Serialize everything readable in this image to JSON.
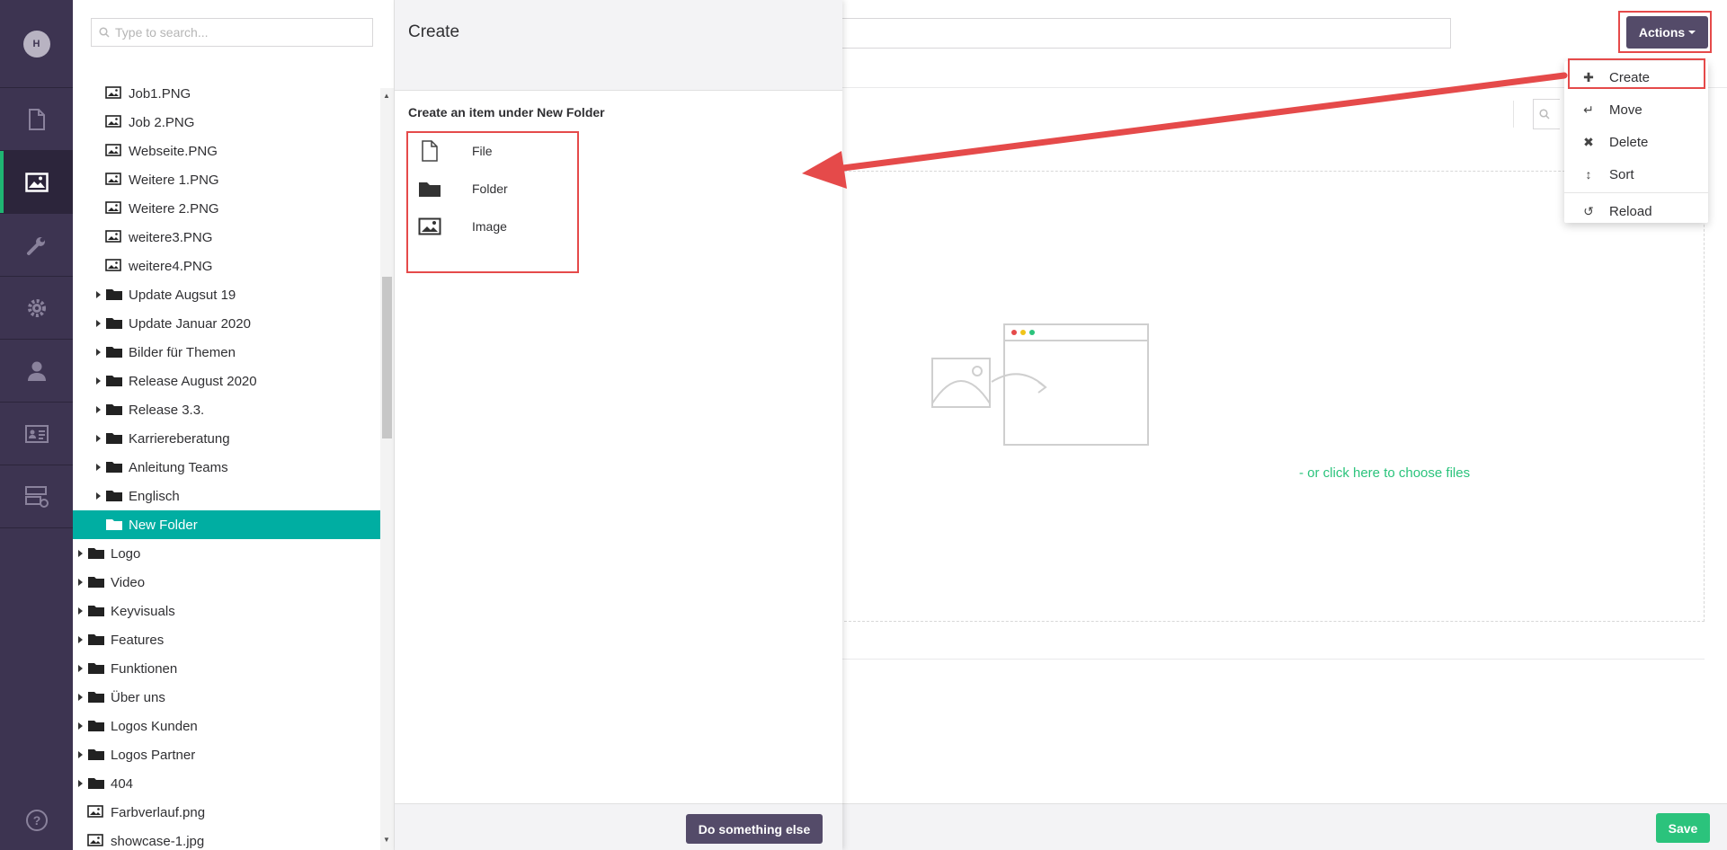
{
  "user": {
    "initial": "H"
  },
  "rail": [
    {
      "icon": "document-icon"
    },
    {
      "icon": "image-icon",
      "active": true
    },
    {
      "icon": "wrench-icon"
    },
    {
      "icon": "gear-icon"
    },
    {
      "icon": "user-icon"
    },
    {
      "icon": "contact-card-icon"
    },
    {
      "icon": "form-icon"
    }
  ],
  "tree": {
    "search_placeholder": "Type to search...",
    "nodes": [
      {
        "label": "Job1.PNG",
        "type": "image",
        "level": 2
      },
      {
        "label": "Job 2.PNG",
        "type": "image",
        "level": 2
      },
      {
        "label": "Webseite.PNG",
        "type": "image",
        "level": 2
      },
      {
        "label": "Weitere 1.PNG",
        "type": "image",
        "level": 2
      },
      {
        "label": "Weitere 2.PNG",
        "type": "image",
        "level": 2
      },
      {
        "label": "weitere3.PNG",
        "type": "image",
        "level": 2
      },
      {
        "label": "weitere4.PNG",
        "type": "image",
        "level": 2
      },
      {
        "label": "Update Augsut 19",
        "type": "folder",
        "level": 2
      },
      {
        "label": "Update Januar 2020",
        "type": "folder",
        "level": 2
      },
      {
        "label": "Bilder für Themen",
        "type": "folder",
        "level": 2
      },
      {
        "label": "Release August 2020",
        "type": "folder",
        "level": 2
      },
      {
        "label": "Release 3.3.",
        "type": "folder",
        "level": 2
      },
      {
        "label": "Karriereberatung",
        "type": "folder",
        "level": 2
      },
      {
        "label": "Anleitung Teams",
        "type": "folder",
        "level": 2
      },
      {
        "label": "Englisch",
        "type": "folder",
        "level": 2
      },
      {
        "label": "New Folder",
        "type": "folder-open",
        "level": 2,
        "selected": true
      },
      {
        "label": "Logo",
        "type": "folder",
        "level": 1
      },
      {
        "label": "Video",
        "type": "folder",
        "level": 1
      },
      {
        "label": "Keyvisuals",
        "type": "folder",
        "level": 1
      },
      {
        "label": "Features",
        "type": "folder",
        "level": 1
      },
      {
        "label": "Funktionen",
        "type": "folder",
        "level": 1
      },
      {
        "label": "Über uns",
        "type": "folder",
        "level": 1
      },
      {
        "label": "Logos Kunden",
        "type": "folder",
        "level": 1
      },
      {
        "label": "Logos Partner",
        "type": "folder",
        "level": 1
      },
      {
        "label": "404",
        "type": "folder",
        "level": 1
      },
      {
        "label": "Farbverlauf.png",
        "type": "image",
        "level": 1
      },
      {
        "label": "showcase-1.jpg",
        "type": "image",
        "level": 1
      }
    ]
  },
  "dialog": {
    "title": "Create",
    "subtitle": "Create an item under New Folder",
    "items": [
      {
        "label": "File",
        "icon": "file-icon"
      },
      {
        "label": "Folder",
        "icon": "folder-icon"
      },
      {
        "label": "Image",
        "icon": "image-icon"
      }
    ],
    "footer_button": "Do something else"
  },
  "main": {
    "actions_label": "Actions",
    "dropzone_link": "- or click here to choose files",
    "save_label": "Save"
  },
  "actions_menu": [
    {
      "label": "Create",
      "icon": "plus-icon"
    },
    {
      "label": "Move",
      "icon": "move-icon"
    },
    {
      "label": "Delete",
      "icon": "delete-icon"
    },
    {
      "label": "Sort",
      "icon": "sort-icon"
    },
    {
      "label": "Reload",
      "icon": "reload-icon"
    }
  ],
  "colors": {
    "rail": "#3d3451",
    "accent": "#00aea2",
    "primary_button": "#544b69",
    "save": "#2bc37c",
    "highlight": "#e54a4a"
  }
}
